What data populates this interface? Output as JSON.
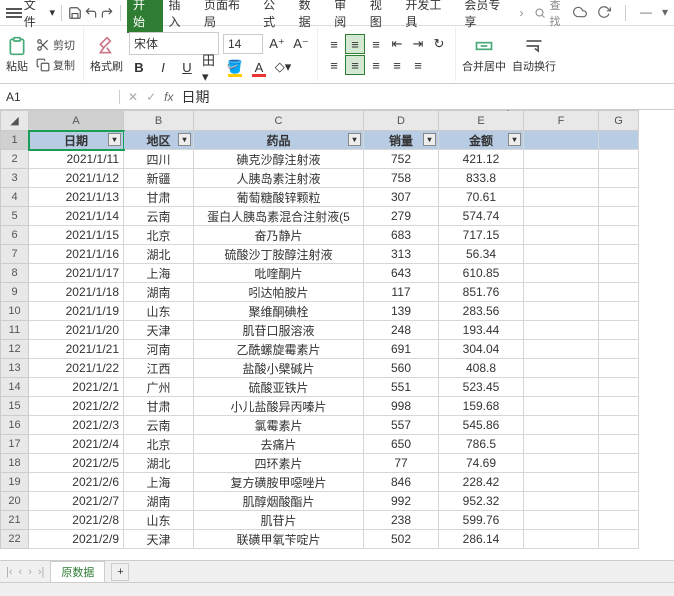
{
  "menu": {
    "file": "文件",
    "tabs": [
      "开始",
      "插入",
      "页面布局",
      "公式",
      "数据",
      "审阅",
      "视图",
      "开发工具",
      "会员专享"
    ],
    "activeTab": 0,
    "search": "查找"
  },
  "ribbon": {
    "paste": "粘贴",
    "cut": "剪切",
    "copy": "复制",
    "formatPainter": "格式刷",
    "fontName": "宋体",
    "fontSize": "14",
    "mergeCenter": "合并居中",
    "autoWrap": "自动换行"
  },
  "nameBox": "A1",
  "fxValue": "日期",
  "columns": [
    "A",
    "B",
    "C",
    "D",
    "E",
    "F",
    "G"
  ],
  "headers": [
    "日期",
    "地区",
    "药品",
    "销量",
    "金额"
  ],
  "rows": [
    {
      "n": 2,
      "d": "2021/1/11",
      "r": "四川",
      "p": "碘克沙醇注射液",
      "q": "752",
      "a": "421.12"
    },
    {
      "n": 3,
      "d": "2021/1/12",
      "r": "新疆",
      "p": "人胰岛素注射液",
      "q": "758",
      "a": "833.8"
    },
    {
      "n": 4,
      "d": "2021/1/13",
      "r": "甘肃",
      "p": "葡萄糖酸锌颗粒",
      "q": "307",
      "a": "70.61"
    },
    {
      "n": 5,
      "d": "2021/1/14",
      "r": "云南",
      "p": "蛋白人胰岛素混合注射液(5",
      "q": "279",
      "a": "574.74"
    },
    {
      "n": 6,
      "d": "2021/1/15",
      "r": "北京",
      "p": "奋乃静片",
      "q": "683",
      "a": "717.15"
    },
    {
      "n": 7,
      "d": "2021/1/16",
      "r": "湖北",
      "p": "硫酸沙丁胺醇注射液",
      "q": "313",
      "a": "56.34"
    },
    {
      "n": 8,
      "d": "2021/1/17",
      "r": "上海",
      "p": "吡喹酮片",
      "q": "643",
      "a": "610.85"
    },
    {
      "n": 9,
      "d": "2021/1/18",
      "r": "湖南",
      "p": "吲达帕胺片",
      "q": "117",
      "a": "851.76"
    },
    {
      "n": 10,
      "d": "2021/1/19",
      "r": "山东",
      "p": "聚维酮碘栓",
      "q": "139",
      "a": "283.56"
    },
    {
      "n": 11,
      "d": "2021/1/20",
      "r": "天津",
      "p": "肌苷口服溶液",
      "q": "248",
      "a": "193.44"
    },
    {
      "n": 12,
      "d": "2021/1/21",
      "r": "河南",
      "p": "乙酰螺旋霉素片",
      "q": "691",
      "a": "304.04"
    },
    {
      "n": 13,
      "d": "2021/1/22",
      "r": "江西",
      "p": "盐酸小檗碱片",
      "q": "560",
      "a": "408.8"
    },
    {
      "n": 14,
      "d": "2021/2/1",
      "r": "广州",
      "p": "硫酸亚铁片",
      "q": "551",
      "a": "523.45"
    },
    {
      "n": 15,
      "d": "2021/2/2",
      "r": "甘肃",
      "p": "小儿盐酸异丙嗪片",
      "q": "998",
      "a": "159.68"
    },
    {
      "n": 16,
      "d": "2021/2/3",
      "r": "云南",
      "p": "氯霉素片",
      "q": "557",
      "a": "545.86"
    },
    {
      "n": 17,
      "d": "2021/2/4",
      "r": "北京",
      "p": "去痛片",
      "q": "650",
      "a": "786.5"
    },
    {
      "n": 18,
      "d": "2021/2/5",
      "r": "湖北",
      "p": "四环素片",
      "q": "77",
      "a": "74.69"
    },
    {
      "n": 19,
      "d": "2021/2/6",
      "r": "上海",
      "p": "复方磺胺甲噁唑片",
      "q": "846",
      "a": "228.42"
    },
    {
      "n": 20,
      "d": "2021/2/7",
      "r": "湖南",
      "p": "肌醇烟酸酯片",
      "q": "992",
      "a": "952.32"
    },
    {
      "n": 21,
      "d": "2021/2/8",
      "r": "山东",
      "p": "肌苷片",
      "q": "238",
      "a": "599.76"
    },
    {
      "n": 22,
      "d": "2021/2/9",
      "r": "天津",
      "p": "联磺甲氧苄啶片",
      "q": "502",
      "a": "286.14"
    }
  ],
  "sheetTab": "原数据"
}
